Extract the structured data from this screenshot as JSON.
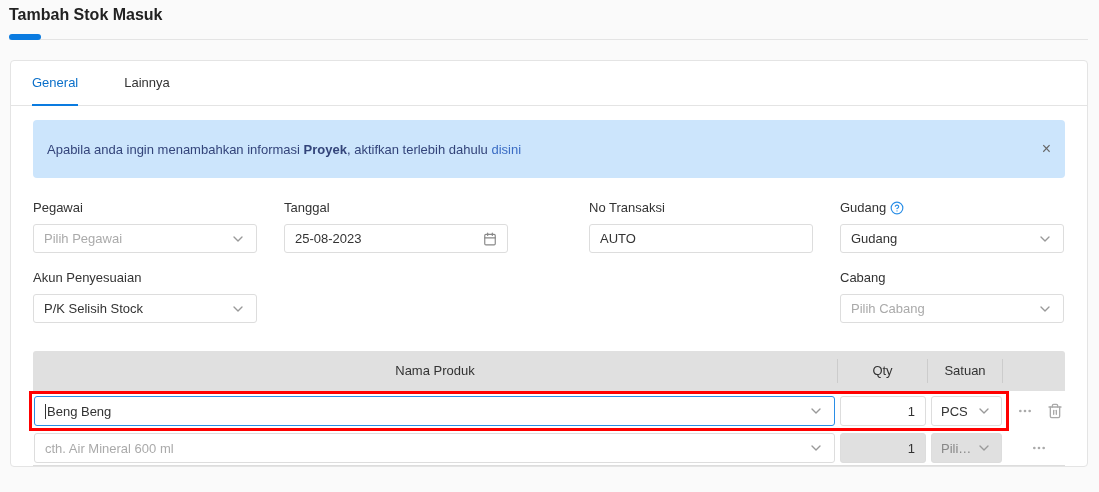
{
  "page_title": "Tambah Stok Masuk",
  "tabs": [
    {
      "label": "General",
      "selected": true
    },
    {
      "label": "Lainnya",
      "selected": false
    }
  ],
  "alert": {
    "message": "Apabila anda ingin menambahkan informasi **Proyek**, aktifkan terlebih dahulu ",
    "link": "disini",
    "close": "×"
  },
  "form_rows": [
    [
      {
        "label": "Pegawai",
        "kind": "select",
        "placeholder": "Pilih Pegawai"
      },
      {
        "label": "Tanggal",
        "kind": "date",
        "value": "25-08-2023"
      },
      {
        "label": "No Transaksi",
        "kind": "text",
        "value": "AUTO"
      },
      {
        "label": "Gudang",
        "kind": "select",
        "value": "Gudang",
        "help": true
      }
    ],
    [
      {
        "label": "Akun Penyesuaian",
        "kind": "select",
        "value": "P/K Selisih Stock"
      },
      {
        "label": "Cabang",
        "kind": "select",
        "placeholder": "Pilih Cabang"
      }
    ]
  ],
  "table": {
    "columns": [
      "Nama Produk",
      "Qty",
      "Satuan"
    ],
    "rows": [
      {
        "product": {
          "value": "Beng Beng",
          "focused": true
        },
        "qty": "1",
        "unit": {
          "value": "PCS"
        },
        "disabled": false,
        "highlighted": true,
        "deletable": true
      },
      {
        "product": {
          "placeholder": "cth. Air Mineral 600 ml",
          "focused": false
        },
        "qty": "1",
        "unit": {
          "placeholder": "Pili…"
        },
        "disabled": true,
        "highlighted": false,
        "deletable": false
      }
    ]
  }
}
